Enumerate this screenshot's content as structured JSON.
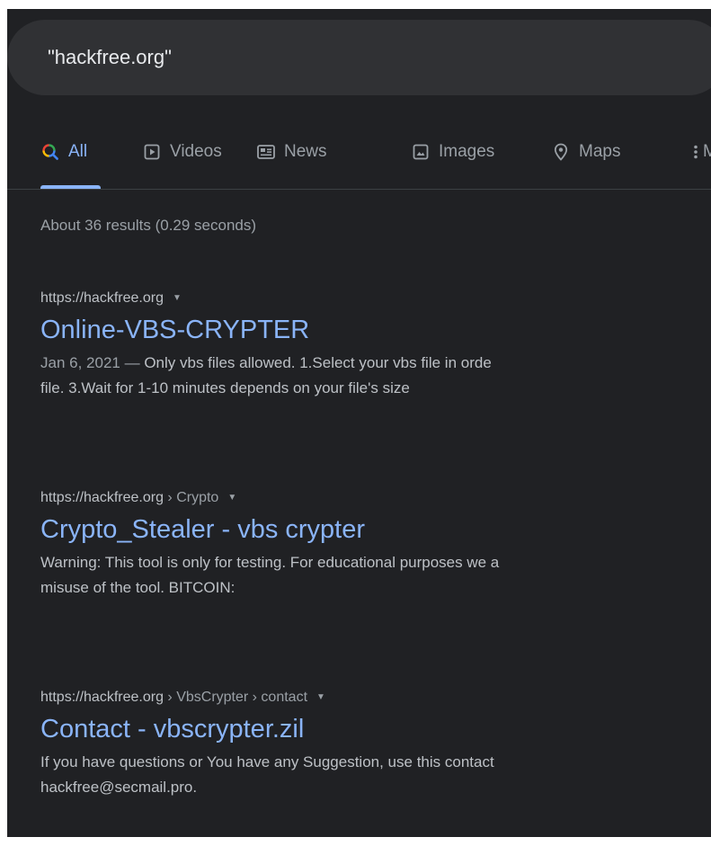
{
  "search": {
    "query": "\"hackfree.org\""
  },
  "tabs": [
    {
      "label": "All",
      "icon": "search-icon"
    },
    {
      "label": "Videos",
      "icon": "video-icon"
    },
    {
      "label": "News",
      "icon": "news-icon"
    },
    {
      "label": "Images",
      "icon": "image-icon"
    },
    {
      "label": "Maps",
      "icon": "map-pin-icon"
    },
    {
      "label": "M",
      "icon": "more-icon"
    }
  ],
  "result_stats": "About 36 results (0.29 seconds)",
  "results": [
    {
      "url": "https://hackfree.org",
      "breadcrumb": "",
      "title": "Online-VBS-CRYPTER",
      "date": "Jan 6, 2021 — ",
      "snippet_line1": "Only vbs files allowed. 1.Select your vbs file in orde",
      "snippet_line2": "file. 3.Wait for 1-10 minutes depends on your file's size"
    },
    {
      "url": "https://hackfree.org",
      "breadcrumb": " › Crypto",
      "title": "Crypto_Stealer - vbs crypter",
      "date": "",
      "snippet_line1": "Warning: This tool is only for testing. For educational purposes we a",
      "snippet_line2": "misuse of the tool. BITCOIN:"
    },
    {
      "url": "https://hackfree.org",
      "breadcrumb": " › VbsCrypter › contact",
      "title": "Contact - vbscrypter.zil",
      "date": "",
      "snippet_line1": "If you have questions or You have any Suggestion, use this contact",
      "snippet_line2": "hackfree@secmail.pro."
    }
  ],
  "colors": {
    "background": "#202124",
    "search_bar": "#303134",
    "link": "#8ab4f8",
    "text": "#bdc1c6",
    "muted": "#9aa0a6",
    "google_blue": "#4285f4",
    "google_red": "#ea4335",
    "google_yellow": "#fbbc05"
  }
}
